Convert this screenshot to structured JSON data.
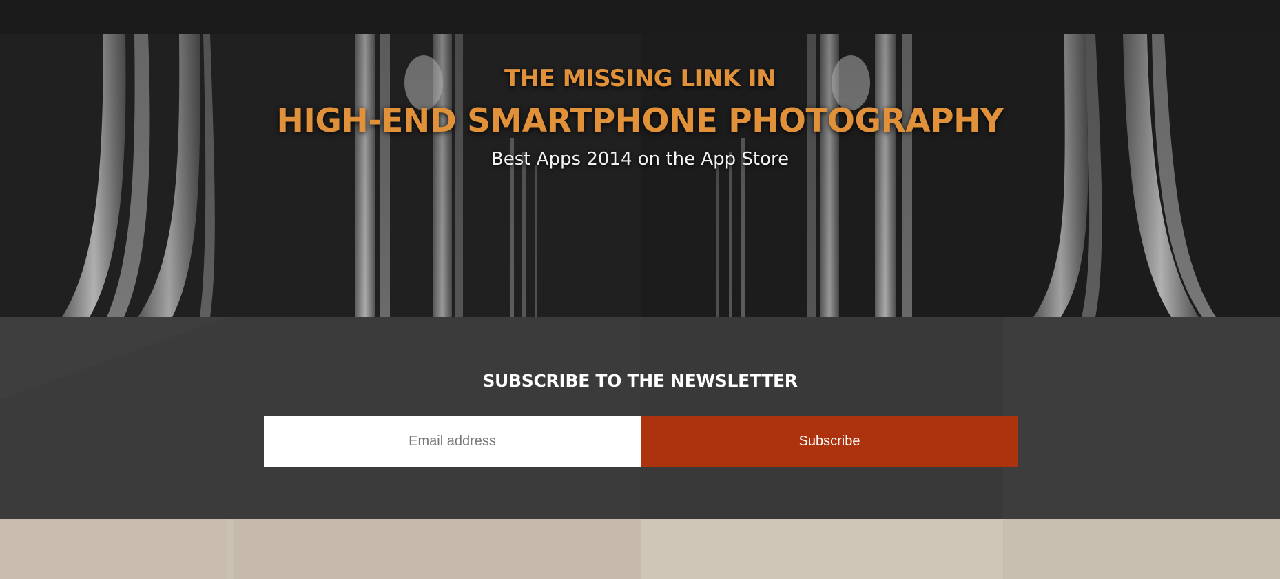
{
  "hero": {
    "line1": "THE MISSING LINK IN",
    "line2": "HIGH-END SMARTPHONE PHOTOGRAPHY",
    "subtitle": "Best Apps 2014 on the App Store",
    "accent_color": "#e0913a"
  },
  "newsletter": {
    "title": "SUBSCRIBE TO THE NEWSLETTER",
    "email_placeholder": "Email address",
    "email_value": "",
    "subscribe_label": "Subscribe",
    "button_color": "#ac330d",
    "background_color": "#3b3b3b"
  },
  "footer_band": {
    "background_color": "#cbc1b3"
  }
}
